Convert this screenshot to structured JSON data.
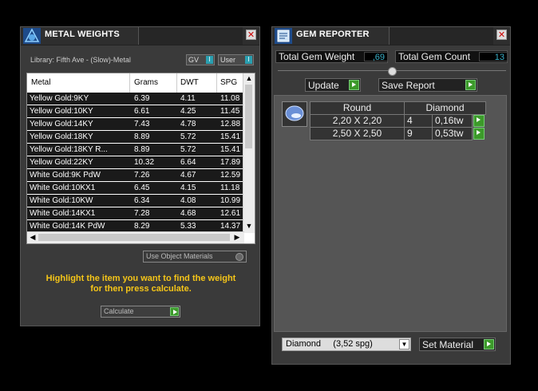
{
  "metal_weights": {
    "title": "METAL WEIGHTS",
    "library": "Library: Fifth Ave - (Slow)-Metal",
    "toggle_gv": "GV",
    "toggle_user": "User",
    "columns": [
      "Metal",
      "Grams",
      "DWT",
      "SPG"
    ],
    "rows": [
      {
        "metal": "Yellow Gold:9KY",
        "grams": "6.39",
        "dwt": "4.11",
        "spg": "11.08"
      },
      {
        "metal": "Yellow Gold:10KY",
        "grams": "6.61",
        "dwt": "4.25",
        "spg": "11.45"
      },
      {
        "metal": "Yellow Gold:14KY",
        "grams": "7.43",
        "dwt": "4.78",
        "spg": "12.88"
      },
      {
        "metal": "Yellow Gold:18KY",
        "grams": "8.89",
        "dwt": "5.72",
        "spg": "15.41"
      },
      {
        "metal": "Yellow Gold:18KY R...",
        "grams": "8.89",
        "dwt": "5.72",
        "spg": "15.41"
      },
      {
        "metal": "Yellow Gold:22KY",
        "grams": "10.32",
        "dwt": "6.64",
        "spg": "17.89"
      },
      {
        "metal": "White Gold:9K PdW",
        "grams": "7.26",
        "dwt": "4.67",
        "spg": "12.59"
      },
      {
        "metal": "White Gold:10KX1",
        "grams": "6.45",
        "dwt": "4.15",
        "spg": "11.18"
      },
      {
        "metal": "White Gold:10KW",
        "grams": "6.34",
        "dwt": "4.08",
        "spg": "10.99"
      },
      {
        "metal": "White Gold:14KX1",
        "grams": "7.28",
        "dwt": "4.68",
        "spg": "12.61"
      },
      {
        "metal": "White Gold:14K PdW",
        "grams": "8.29",
        "dwt": "5.33",
        "spg": "14.37"
      }
    ],
    "use_object_materials": "Use Object Materials",
    "hint_line1": "Highlight the item you want to find the weight",
    "hint_line2": "for then press calculate.",
    "calculate_label": "Calculate"
  },
  "gem_reporter": {
    "title": "GEM REPORTER",
    "total_gem_weight_label": "Total Gem Weight",
    "total_gem_weight_value": ",69",
    "total_gem_count_label": "Total Gem Count",
    "total_gem_count_value": "13",
    "update_label": "Update",
    "save_report_label": "Save Report",
    "table": {
      "shape": "Round",
      "material": "Diamond",
      "rows": [
        {
          "size": "2,20 X 2,20",
          "count": "4",
          "weight": "0,16tw"
        },
        {
          "size": "2,50 X 2,50",
          "count": "9",
          "weight": "0,53tw"
        }
      ]
    },
    "material_select": "Diamond     (3,52 spg)",
    "set_material_label": "Set Material"
  }
}
